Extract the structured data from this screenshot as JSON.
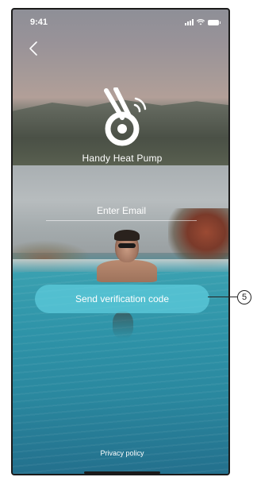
{
  "status_bar": {
    "time": "9:41"
  },
  "app": {
    "name": "Handy Heat Pump"
  },
  "email": {
    "placeholder": "Enter Email",
    "value": ""
  },
  "actions": {
    "send_code_label": "Send verification code"
  },
  "footer": {
    "privacy_label": "Privacy policy"
  },
  "annotation": {
    "number": "5"
  },
  "colors": {
    "button": "#5ecdde",
    "text": "#ffffff",
    "water": "#2e93a8"
  },
  "icons": [
    "chevron-left-icon",
    "signal-icon",
    "wifi-icon",
    "battery-icon",
    "heat-pump-logo-icon"
  ]
}
